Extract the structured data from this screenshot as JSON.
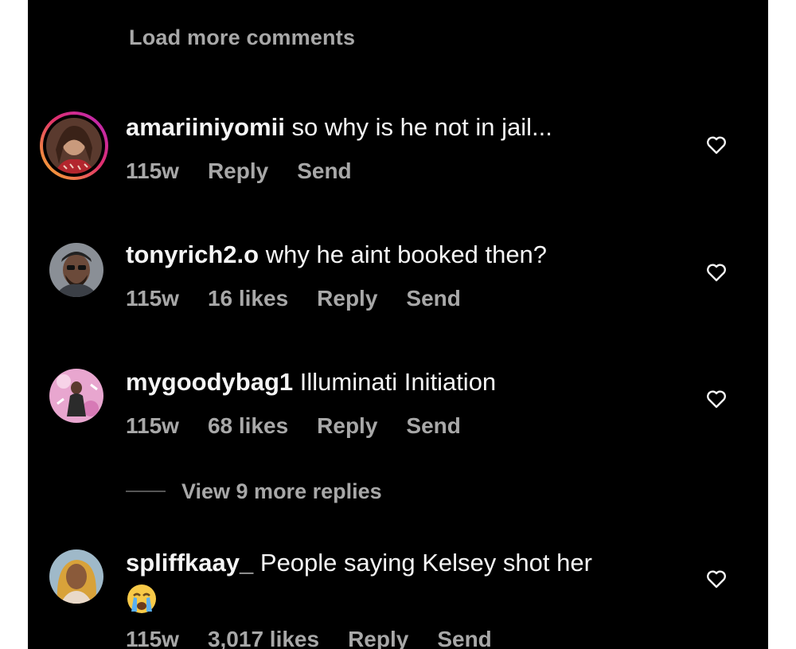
{
  "load_more_label": "Load more comments",
  "comments": [
    {
      "username": "amariiniyomii",
      "text": "so why is he not in jail...",
      "time": "115w",
      "likes": "",
      "reply_label": "Reply",
      "send_label": "Send"
    },
    {
      "username": "tonyrich2.o",
      "text": "why he aint booked then?",
      "time": "115w",
      "likes": "16 likes",
      "reply_label": "Reply",
      "send_label": "Send"
    },
    {
      "username": "mygoodybag1",
      "text": "Illuminati Initiation",
      "time": "115w",
      "likes": "68 likes",
      "reply_label": "Reply",
      "send_label": "Send",
      "view_replies_label": "View 9 more replies"
    },
    {
      "username": "spliffkaay_",
      "text": "People saying Kelsey shot her",
      "time": "115w",
      "likes": "3,017 likes",
      "reply_label": "Reply",
      "send_label": "Send"
    }
  ],
  "icons": {
    "like": "heart-outline-icon",
    "emoji": "loudly-crying-face-emoji"
  },
  "colors": {
    "background": "#000000",
    "primary_text": "#f5f5f5",
    "secondary_text": "#a8a8a8"
  }
}
